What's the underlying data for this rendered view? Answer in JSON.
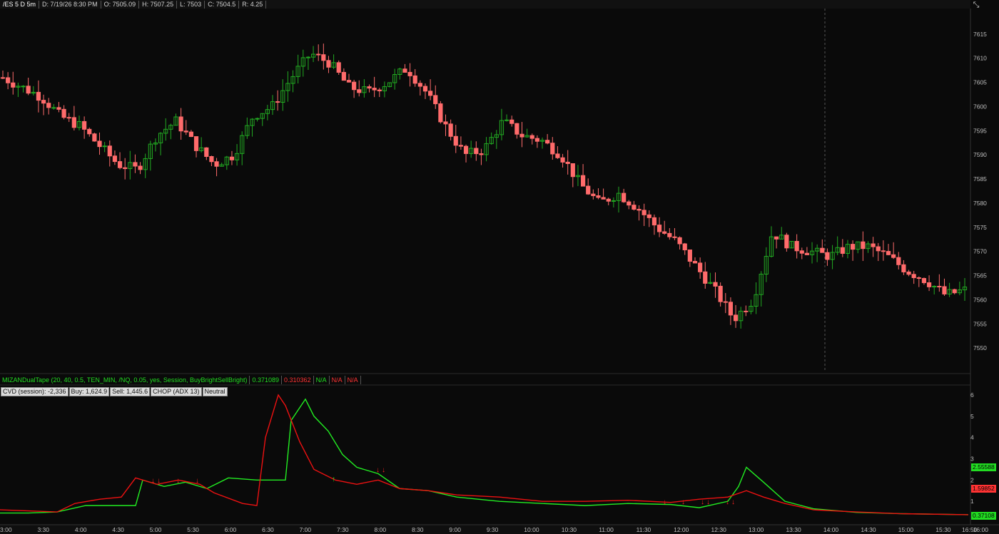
{
  "header": {
    "symbol": "/ES 5 D 5m",
    "fields": [
      "D: 7/19/26 8:30 PM",
      "O: 7505.09",
      "H: 7507.25",
      "L: 7503",
      "C: 7504.5",
      "R: 4.25"
    ]
  },
  "price_axis": {
    "ticks": [
      "7615",
      "7610",
      "7605",
      "7600",
      "7595",
      "7590",
      "7585",
      "7580",
      "7575",
      "7570",
      "7565",
      "7560",
      "7555",
      "7550"
    ]
  },
  "study": {
    "title": "MIZANDualTape (20, 40, 0.5, TEN_MIN, /NQ, 0.05, yes, Session, BuyBrightSellBright)",
    "values": [
      "0.371089",
      "0.310362",
      "N/A",
      "N/A",
      "N/A"
    ],
    "value_colors": [
      "#22dd22",
      "#ff3333",
      "#22dd22",
      "#ff3333",
      "#ff3333"
    ]
  },
  "info_bar": [
    "CVD (session): -2,336",
    "Buy: 1,624.9",
    "Sell: 1,445.6",
    "CHOP (ADX 13)",
    "Neutral"
  ],
  "study_axis": {
    "ticks": [
      "6",
      "5",
      "4",
      "3",
      "2",
      "1"
    ]
  },
  "badges": [
    {
      "text": "2.55588",
      "bg": "#22dd22"
    },
    {
      "text": "1.59852",
      "bg": "#ff3333"
    },
    {
      "text": "0.37108",
      "bg": "#22dd22"
    }
  ],
  "time_axis": [
    "3:00",
    "3:30",
    "4:00",
    "4:30",
    "5:00",
    "5:30",
    "6:00",
    "6:30",
    "7:00",
    "7:30",
    "8:00",
    "8:30",
    "9:00",
    "9:30",
    "10:00",
    "10:30",
    "11:00",
    "11:30",
    "12:00",
    "12:30",
    "13:00",
    "13:30",
    "14:00",
    "14:30",
    "15:00",
    "15:30",
    "16:00",
    "16:30",
    "16:50"
  ],
  "colors": {
    "up": "#22aa22",
    "down": "#ff6b6b",
    "buy_line": "#22ee22",
    "sell_line": "#ee1111",
    "background": "#0a0a0a"
  },
  "chart_data": [
    {
      "type": "candlestick",
      "title": "/ES 5 D 5m",
      "ylim": [
        7545,
        7620
      ],
      "x_range": [
        "3:00",
        "16:50"
      ],
      "closes_approx": [
        7606,
        7604,
        7602,
        7598,
        7596,
        7592,
        7588,
        7587,
        7594,
        7597,
        7592,
        7588,
        7590,
        7598,
        7600,
        7606,
        7611,
        7609,
        7604,
        7603,
        7605,
        7608,
        7603,
        7596,
        7590,
        7591,
        7597,
        7594,
        7593,
        7590,
        7584,
        7580,
        7582,
        7579,
        7575,
        7572,
        7567,
        7562,
        7556,
        7560,
        7574,
        7571,
        7570,
        7569,
        7571,
        7571,
        7569,
        7566,
        7564,
        7561,
        7562
      ]
    },
    {
      "type": "line",
      "title": "MIZANDualTape",
      "ylim": [
        0,
        6.3
      ],
      "series": [
        {
          "name": "Buy",
          "color": "#22ee22",
          "points": [
            [
              0,
              0.45
            ],
            [
              40,
              0.45
            ],
            [
              80,
              0.5
            ],
            [
              120,
              0.8
            ],
            [
              150,
              0.8
            ],
            [
              190,
              0.8
            ],
            [
              200,
              2.0
            ],
            [
              230,
              1.7
            ],
            [
              260,
              1.9
            ],
            [
              290,
              1.6
            ],
            [
              320,
              2.1
            ],
            [
              360,
              2.0
            ],
            [
              400,
              2.0
            ],
            [
              408,
              4.8
            ],
            [
              428,
              5.8
            ],
            [
              440,
              5.0
            ],
            [
              460,
              4.3
            ],
            [
              480,
              3.2
            ],
            [
              500,
              2.6
            ],
            [
              530,
              2.3
            ],
            [
              560,
              1.6
            ],
            [
              600,
              1.5
            ],
            [
              640,
              1.2
            ],
            [
              700,
              1.0
            ],
            [
              760,
              0.9
            ],
            [
              820,
              0.8
            ],
            [
              880,
              0.9
            ],
            [
              940,
              0.85
            ],
            [
              980,
              0.7
            ],
            [
              1020,
              1.0
            ],
            [
              1035,
              1.7
            ],
            [
              1046,
              2.6
            ],
            [
              1070,
              1.9
            ],
            [
              1100,
              1.0
            ],
            [
              1140,
              0.65
            ],
            [
              1200,
              0.48
            ],
            [
              1260,
              0.42
            ],
            [
              1357,
              0.37
            ]
          ]
        },
        {
          "name": "Sell",
          "color": "#ee1111",
          "points": [
            [
              0,
              0.6
            ],
            [
              40,
              0.55
            ],
            [
              80,
              0.5
            ],
            [
              105,
              0.9
            ],
            [
              140,
              1.1
            ],
            [
              170,
              1.2
            ],
            [
              190,
              2.1
            ],
            [
              220,
              1.8
            ],
            [
              250,
              2.0
            ],
            [
              280,
              1.8
            ],
            [
              300,
              1.4
            ],
            [
              340,
              0.9
            ],
            [
              360,
              0.8
            ],
            [
              372,
              4.0
            ],
            [
              390,
              6.0
            ],
            [
              400,
              5.5
            ],
            [
              420,
              3.8
            ],
            [
              440,
              2.5
            ],
            [
              470,
              2.0
            ],
            [
              500,
              1.8
            ],
            [
              530,
              2.0
            ],
            [
              560,
              1.6
            ],
            [
              600,
              1.5
            ],
            [
              640,
              1.3
            ],
            [
              700,
              1.2
            ],
            [
              760,
              1.0
            ],
            [
              820,
              1.0
            ],
            [
              880,
              1.05
            ],
            [
              940,
              0.95
            ],
            [
              980,
              1.1
            ],
            [
              1020,
              1.2
            ],
            [
              1046,
              1.5
            ],
            [
              1070,
              1.2
            ],
            [
              1100,
              0.9
            ],
            [
              1140,
              0.6
            ],
            [
              1200,
              0.5
            ],
            [
              1260,
              0.42
            ],
            [
              1357,
              0.37
            ]
          ]
        }
      ],
      "buy_arrows_x": [
        468
      ],
      "sell_arrows_x": [
        215,
        223,
        250,
        277,
        530,
        538,
        932,
        958,
        985,
        993,
        1020,
        1028
      ]
    }
  ]
}
